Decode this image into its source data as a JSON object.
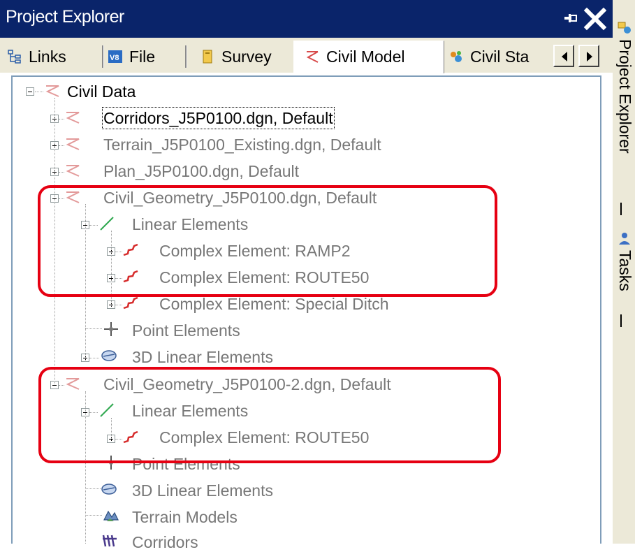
{
  "window": {
    "title": "Project Explorer"
  },
  "tabs": [
    {
      "label": "Links",
      "icon": "links-icon"
    },
    {
      "label": "File",
      "icon": "file-icon"
    },
    {
      "label": "Survey",
      "icon": "survey-icon"
    },
    {
      "label": "Civil Model",
      "icon": "civil-model-icon",
      "active": true
    },
    {
      "label": "Civil Sta",
      "icon": "civil-standards-icon"
    }
  ],
  "tree": {
    "root": "Civil Data",
    "items": [
      {
        "label": "Corridors_J5P0100.dgn, Default",
        "icon": "civil-z-icon",
        "state": "collapsed"
      },
      {
        "label": "Terrain_J5P0100_Existing.dgn, Default",
        "icon": "civil-z-icon",
        "state": "collapsed"
      },
      {
        "label": "Plan_J5P0100.dgn, Default",
        "icon": "civil-z-icon",
        "state": "collapsed"
      },
      {
        "label": "Civil_Geometry_J5P0100.dgn, Default",
        "icon": "civil-z-icon",
        "state": "expanded"
      },
      {
        "label": "Linear Elements",
        "icon": "linear-element-icon",
        "state": "expanded"
      },
      {
        "label": "Complex Element: RAMP2",
        "icon": "complex-element-icon",
        "state": "collapsed"
      },
      {
        "label": "Complex Element: ROUTE50",
        "icon": "complex-element-icon",
        "state": "collapsed"
      },
      {
        "label": "Complex Element: Special Ditch",
        "icon": "complex-element-icon",
        "state": "collapsed"
      },
      {
        "label": "Point Elements",
        "icon": "point-element-icon"
      },
      {
        "label": "3D Linear Elements",
        "icon": "3d-linear-element-icon",
        "state": "collapsed"
      },
      {
        "label": "Civil_Geometry_J5P0100-2.dgn, Default",
        "icon": "civil-z-icon",
        "state": "expanded"
      },
      {
        "label": "Linear Elements",
        "icon": "linear-element-icon",
        "state": "expanded"
      },
      {
        "label": "Complex Element: ROUTE50",
        "icon": "complex-element-icon",
        "state": "collapsed"
      },
      {
        "label": "Point Elements",
        "icon": "point-element-icon"
      },
      {
        "label": "3D Linear Elements",
        "icon": "3d-linear-element-icon"
      },
      {
        "label": "Terrain Models",
        "icon": "terrain-model-icon"
      },
      {
        "label": "Corridors",
        "icon": "corridor-icon"
      }
    ]
  },
  "sidebar": {
    "project_explorer_label": "Project Explorer",
    "tasks_label": "Tasks"
  },
  "colors": {
    "title_bar": "#0a246a",
    "highlight_outline": "#e60012",
    "civil_icon": "#d84a4a",
    "linear_icon": "#2fa84f"
  }
}
